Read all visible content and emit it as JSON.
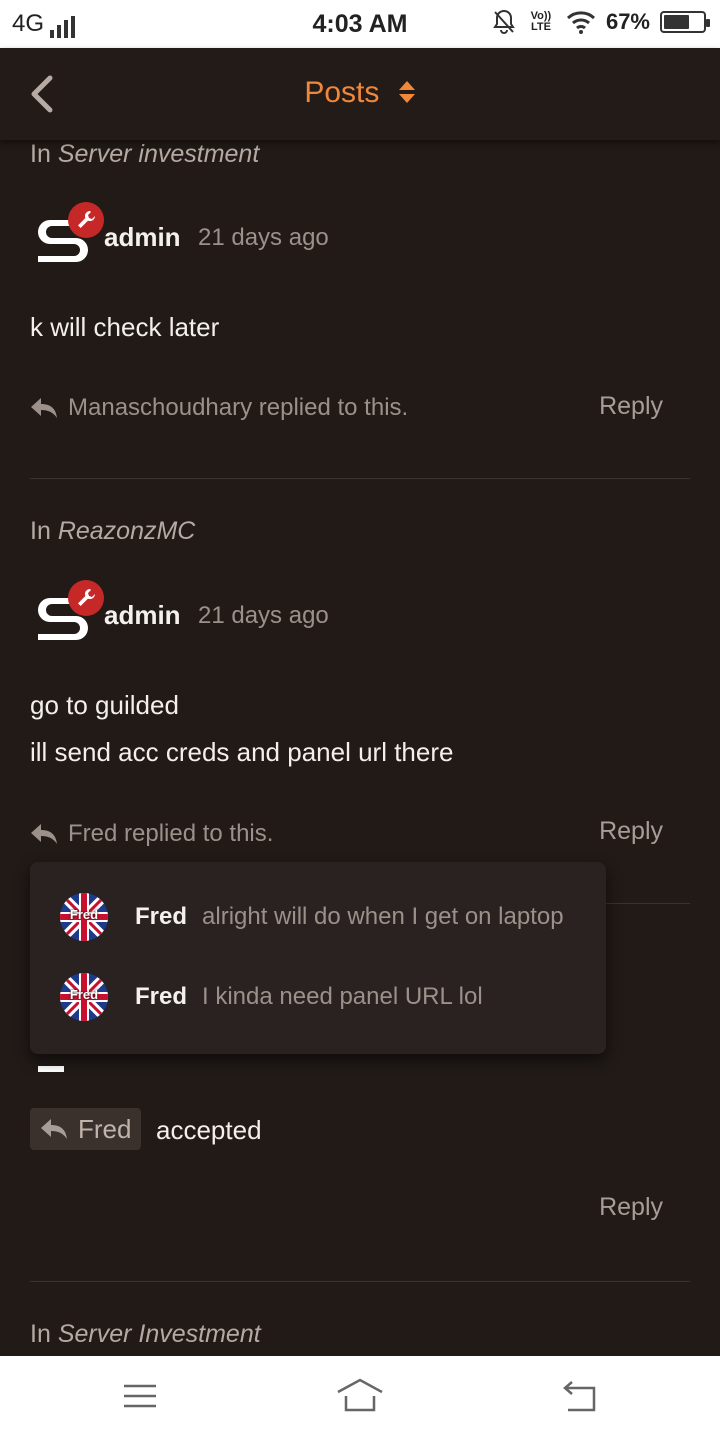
{
  "status_bar": {
    "network": "4G",
    "time": "4:03 AM",
    "volte": "Vo)) LTE",
    "battery_pct_label": "67%",
    "battery_level": 0.67
  },
  "header": {
    "title": "Posts",
    "back_icon": "chevron-left-icon",
    "sort_icon": "sort-updown-icon",
    "accent_color": "#f0873a"
  },
  "posts": [
    {
      "in_prefix": "In",
      "topic": "Server investment",
      "author": "admin",
      "time": "21 days ago",
      "lines": [
        "k will check later"
      ],
      "replied_text": "Manaschoudhary replied to this.",
      "reply_label": "Reply"
    },
    {
      "in_prefix": "In",
      "topic": "ReazonzMC",
      "author": "admin",
      "time": "21 days ago",
      "lines": [
        "go to guilded",
        "ill send acc creds and panel url there"
      ],
      "replied_text": "Fred replied to this.",
      "reply_label": "Reply"
    },
    {
      "chip_user": "Fred",
      "chip_text": "accepted",
      "reply_label": "Reply"
    },
    {
      "in_prefix": "In",
      "topic": "Server Investment"
    }
  ],
  "replies_popup": [
    {
      "avatar_label": "Fred",
      "name": "Fred",
      "message": "alright will do when I get on laptop"
    },
    {
      "avatar_label": "Fred",
      "name": "Fred",
      "message": "I kinda need panel URL lol"
    }
  ],
  "nav_bar": {
    "menu_icon": "menu-icon",
    "home_icon": "home-icon",
    "back_icon": "back-arrow-icon"
  }
}
